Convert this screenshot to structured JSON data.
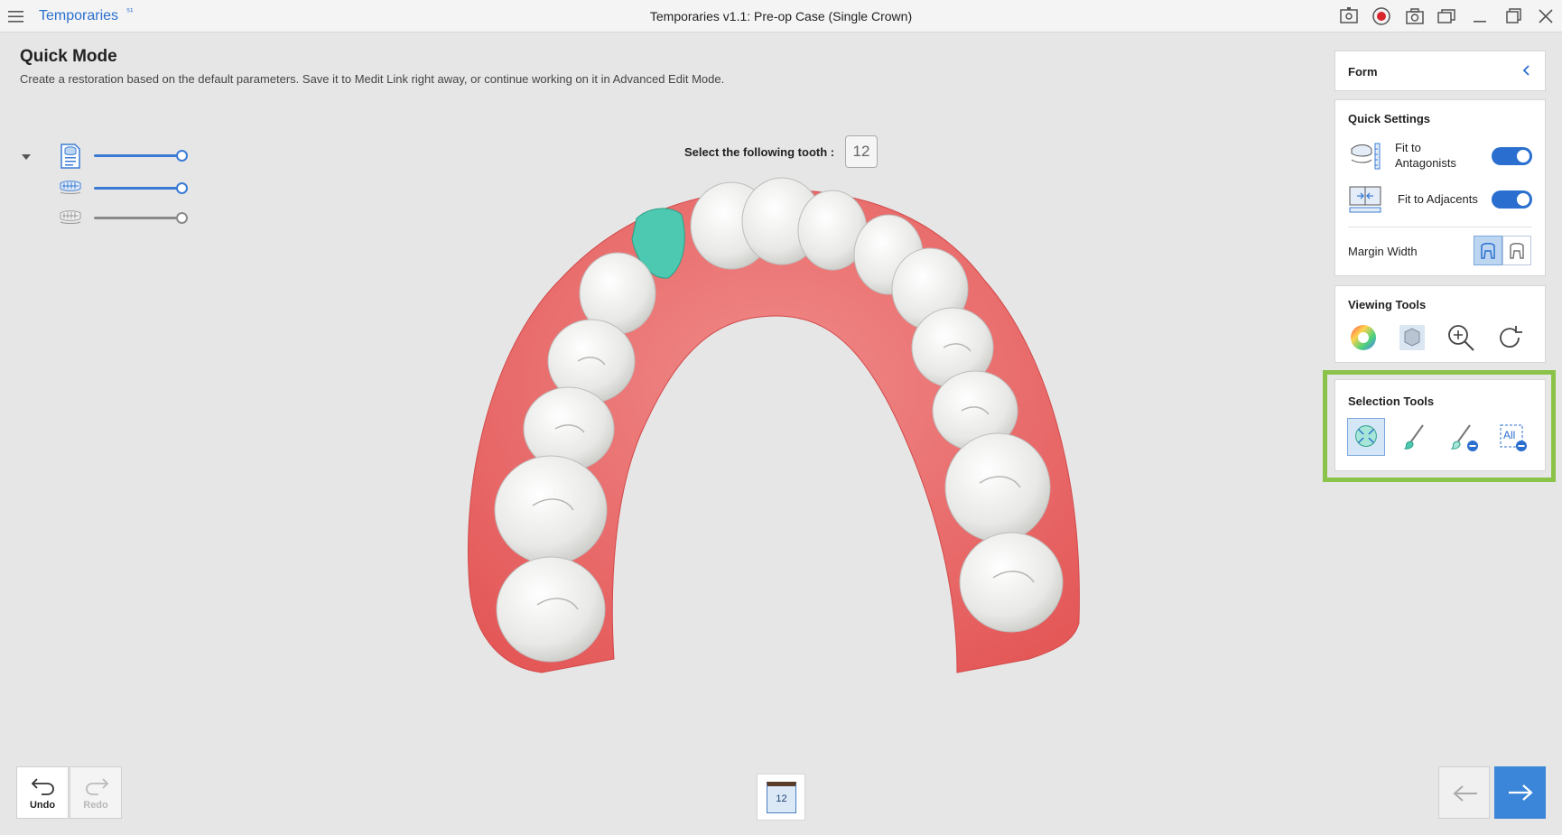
{
  "titlebar": {
    "app_name": "Temporaries",
    "app_badge": "⁵¹",
    "window_title": "Temporaries v1.1: Pre-op Case (Single Crown)",
    "icons": [
      "menu-icon",
      "screen-capture-icon",
      "record-icon",
      "camera-icon",
      "window-icon",
      "minimize-icon",
      "maximize-icon",
      "close-icon"
    ]
  },
  "header": {
    "title": "Quick Mode",
    "description": "Create a restoration based on the default parameters. Save it to Medit Link right away, or continue working on it in Advanced Edit Mode."
  },
  "layers": [
    {
      "name": "restoration-layer",
      "opacity": 1.0,
      "color": "#3b7bd6"
    },
    {
      "name": "pre-op-layer",
      "opacity": 1.0,
      "color": "#3b7bd6"
    },
    {
      "name": "antagonist-layer",
      "opacity": 1.0,
      "color": "#888888"
    }
  ],
  "prompt": {
    "label": "Select the following tooth :",
    "tooth_number": "12"
  },
  "right_panel": {
    "form": {
      "title": "Form"
    },
    "quick_settings": {
      "title": "Quick Settings",
      "fit_antagonists": {
        "label": "Fit to\nAntagonists",
        "enabled": true
      },
      "fit_adjacents": {
        "label": "Fit to Adjacents",
        "enabled": true
      },
      "margin_width": {
        "label": "Margin Width",
        "selected": "narrow"
      }
    },
    "viewing_tools": {
      "title": "Viewing Tools",
      "tools": [
        "color-wheel-icon",
        "cube-view-icon",
        "zoom-icon",
        "reset-view-icon"
      ]
    },
    "selection_tools": {
      "title": "Selection Tools",
      "tools": [
        "smart-select-icon",
        "brush-select-icon",
        "brush-deselect-icon",
        "deselect-all-icon"
      ],
      "selected": "smart-select-icon",
      "all_label": "All"
    }
  },
  "bottom": {
    "undo_label": "Undo",
    "redo_label": "Redo",
    "tooth_chip": "12"
  },
  "colors": {
    "accent": "#2a6fcf",
    "gum": "#e86a6a",
    "selected_tooth": "#4cc9b0",
    "highlight": "#8bc34a"
  }
}
